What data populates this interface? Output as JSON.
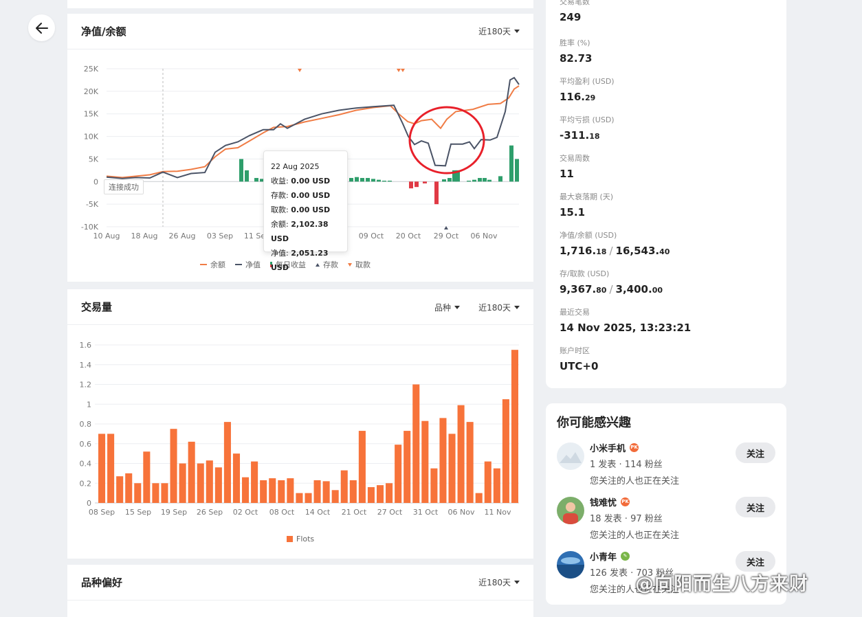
{
  "nav": {
    "back_icon": "arrow-left-icon"
  },
  "equity_card": {
    "title": "净值/余额",
    "range": "近180天",
    "y_ticks": [
      "25K",
      "20K",
      "15K",
      "10K",
      "5K",
      "0",
      "-5K",
      "-10K"
    ],
    "x_ticks": [
      "10 Aug",
      "18 Aug",
      "26 Aug",
      "03 Sep",
      "11 Sep",
      "09 Oct",
      "20 Oct",
      "29 Oct",
      "06 Nov"
    ],
    "legend": [
      "余额",
      "净值",
      "每日收益",
      "存款",
      "取款"
    ],
    "toast": "连接成功",
    "tooltip": {
      "date": "22 Aug 2025",
      "rows": [
        {
          "label": "收益:",
          "value": "0.00 USD"
        },
        {
          "label": "存款:",
          "value": "0.00 USD"
        },
        {
          "label": "取款:",
          "value": "0.00 USD"
        },
        {
          "label": "余额:",
          "value": "2,102.38 USD"
        },
        {
          "label": "净值:",
          "value": "2,051.23 USD"
        }
      ]
    }
  },
  "volume_card": {
    "title": "交易量",
    "filter": "品种",
    "range": "近180天",
    "legend": "Flots"
  },
  "pref_card": {
    "title": "品种偏好",
    "range": "近180天"
  },
  "chart_data": [
    {
      "type": "line",
      "title": "净值/余额",
      "ylim": [
        -10000,
        25000
      ],
      "x": [
        "10 Aug",
        "18 Aug",
        "26 Aug",
        "03 Sep",
        "11 Sep",
        "09 Oct",
        "20 Oct",
        "29 Oct",
        "06 Nov"
      ],
      "series": [
        {
          "name": "余额",
          "color": "#f07c45",
          "values": [
            1000,
            1300,
            2200,
            7500,
            12000,
            16800,
            12500,
            15500,
            16543
          ]
        },
        {
          "name": "净值",
          "color": "#4a5366",
          "values": [
            1000,
            1300,
            2000,
            7000,
            12200,
            16800,
            7500,
            8500,
            16000
          ]
        }
      ],
      "daily_profit_color_pos": "#2e9e6b",
      "daily_profit_color_neg": "#e03a45"
    },
    {
      "type": "bar",
      "title": "交易量",
      "series_name": "Flots",
      "color": "#f7733a",
      "ylim": [
        0,
        1.6
      ],
      "y_ticks": [
        "1.6",
        "1.4",
        "1.2",
        "1",
        "0.8",
        "0.6",
        "0.4",
        "0.2",
        "0"
      ],
      "x_ticks": [
        "08 Sep",
        "15 Sep",
        "19 Sep",
        "26 Sep",
        "02 Oct",
        "08 Oct",
        "14 Oct",
        "21 Oct",
        "27 Oct",
        "31 Oct",
        "06 Nov",
        "11 Nov"
      ],
      "values": [
        0.7,
        0.7,
        0.27,
        0.3,
        0.2,
        0.52,
        0.2,
        0.2,
        0.75,
        0.4,
        0.62,
        0.4,
        0.43,
        0.36,
        0.82,
        0.5,
        0.26,
        0.42,
        0.23,
        0.25,
        0.23,
        0.25,
        0.1,
        0.1,
        0.23,
        0.22,
        0.13,
        0.33,
        0.23,
        0.73,
        0.16,
        0.18,
        0.2,
        0.59,
        0.73,
        1.2,
        0.83,
        0.35,
        0.86,
        0.7,
        0.99,
        0.82,
        0.1,
        0.42,
        0.35,
        1.05,
        1.55
      ]
    }
  ],
  "stats": [
    {
      "label": "交易笔数",
      "value": "249"
    },
    {
      "label": "胜率 (%)",
      "value": "82.73"
    },
    {
      "label": "平均盈利 (USD)",
      "value": "116.",
      "dec": "29"
    },
    {
      "label": "平均亏损 (USD)",
      "value": "-311.",
      "dec": "18"
    },
    {
      "label": "交易周数",
      "value": "11"
    },
    {
      "label": "最大衰落期 (天)",
      "value": "15.1"
    },
    {
      "label": "净值/余额 (USD)",
      "value": "1,716.",
      "dec": "18",
      "value2": "16,543.",
      "dec2": "40"
    },
    {
      "label": "存/取款 (USD)",
      "value": "9,367.",
      "dec": "80",
      "value2": "3,400.",
      "dec2": "00"
    },
    {
      "label": "最近交易",
      "value": "14 Nov 2025, 13:23:21"
    },
    {
      "label": "账户时区",
      "value": "UTC+0"
    }
  ],
  "interest": {
    "title": "你可能感兴趣",
    "people": [
      {
        "name": "小米手机",
        "meta": "1 发表 · 114 粉丝",
        "note": "您关注的人也正在关注",
        "follow": "关注"
      },
      {
        "name": "钱难忧",
        "meta": "18 发表 · 97 粉丝",
        "note": "您关注的人也正在关注",
        "follow": "关注"
      },
      {
        "name": "小青年",
        "meta": "126 发表 · 703 粉丝",
        "note": "您关注的人也正在关注",
        "follow": "关注"
      }
    ]
  },
  "watermark": "@向阳而生八方来财"
}
